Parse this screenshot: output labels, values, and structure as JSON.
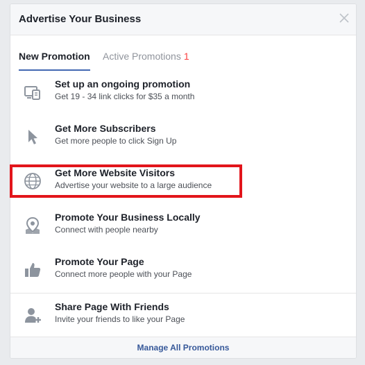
{
  "dialog": {
    "title": "Advertise Your Business",
    "close_icon": "close-icon"
  },
  "tabs": [
    {
      "label": "New Promotion",
      "selected": true
    },
    {
      "label": "Active Promotions",
      "count": "1"
    }
  ],
  "items": [
    {
      "icon": "computer-icon",
      "title": "Set up an ongoing promotion",
      "subtitle": "Get 19 - 34 link clicks for $35 a month"
    },
    {
      "icon": "cursor-icon",
      "title": "Get More Subscribers",
      "subtitle": "Get more people to click Sign Up"
    },
    {
      "icon": "globe-icon",
      "title": "Get More Website Visitors",
      "subtitle": "Advertise your website to a large audience",
      "highlighted": true
    },
    {
      "icon": "location-pin-icon",
      "title": "Promote Your Business Locally",
      "subtitle": "Connect with people nearby"
    },
    {
      "icon": "thumbs-up-icon",
      "title": "Promote Your Page",
      "subtitle": "Connect more people with your Page"
    },
    {
      "icon": "add-friend-icon",
      "title": "Share Page With Friends",
      "subtitle": "Invite your friends to like your Page"
    }
  ],
  "footer": {
    "link": "Manage All Promotions"
  },
  "colors": {
    "highlight": "#e2151b",
    "link": "#365899",
    "tab_underline": "#4267b2",
    "badge": "#fa3e3e"
  }
}
